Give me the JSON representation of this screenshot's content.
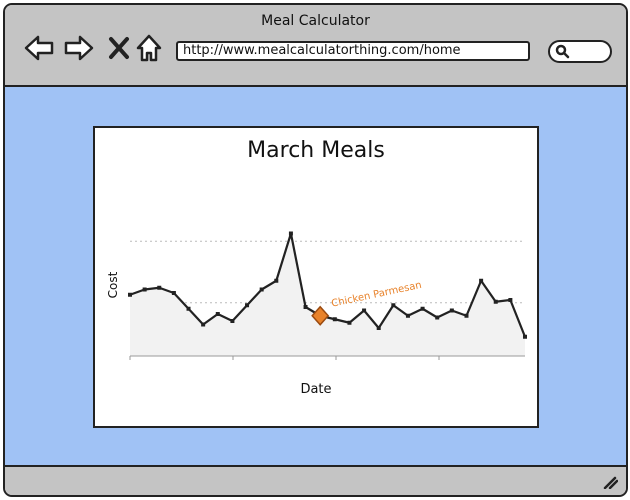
{
  "window": {
    "title": "Meal Calculator"
  },
  "toolbar": {
    "url": "http://www.mealcalculatorthing.com/home",
    "back_icon": "back-arrow-icon",
    "forward_icon": "forward-arrow-icon",
    "stop_icon": "close-icon",
    "home_icon": "home-icon",
    "search_icon": "search-icon"
  },
  "colors": {
    "content_bg": "#a0c2f5",
    "chrome_bg": "#c4c4c4",
    "highlight": "#e8822a",
    "line": "#222222"
  },
  "chart_data": {
    "type": "line",
    "title": "March Meals",
    "xlabel": "Date",
    "ylabel": "Cost",
    "grid": true,
    "x": [
      1,
      2,
      3,
      4,
      5,
      6,
      7,
      8,
      9,
      10,
      11,
      12,
      13,
      14,
      15,
      16,
      17,
      18,
      19,
      20,
      21,
      22,
      23,
      24,
      25,
      26,
      27,
      28,
      29,
      30,
      31
    ],
    "y": [
      45,
      48,
      49,
      46,
      37,
      28,
      34,
      30,
      39,
      48,
      53,
      80,
      38,
      33,
      31,
      29,
      36,
      26,
      39,
      33,
      37,
      32,
      36,
      33,
      53,
      41,
      42,
      21
    ],
    "highlight": {
      "index": 13,
      "label": "Chicken Parmesan"
    },
    "ylim": [
      10,
      90
    ]
  }
}
